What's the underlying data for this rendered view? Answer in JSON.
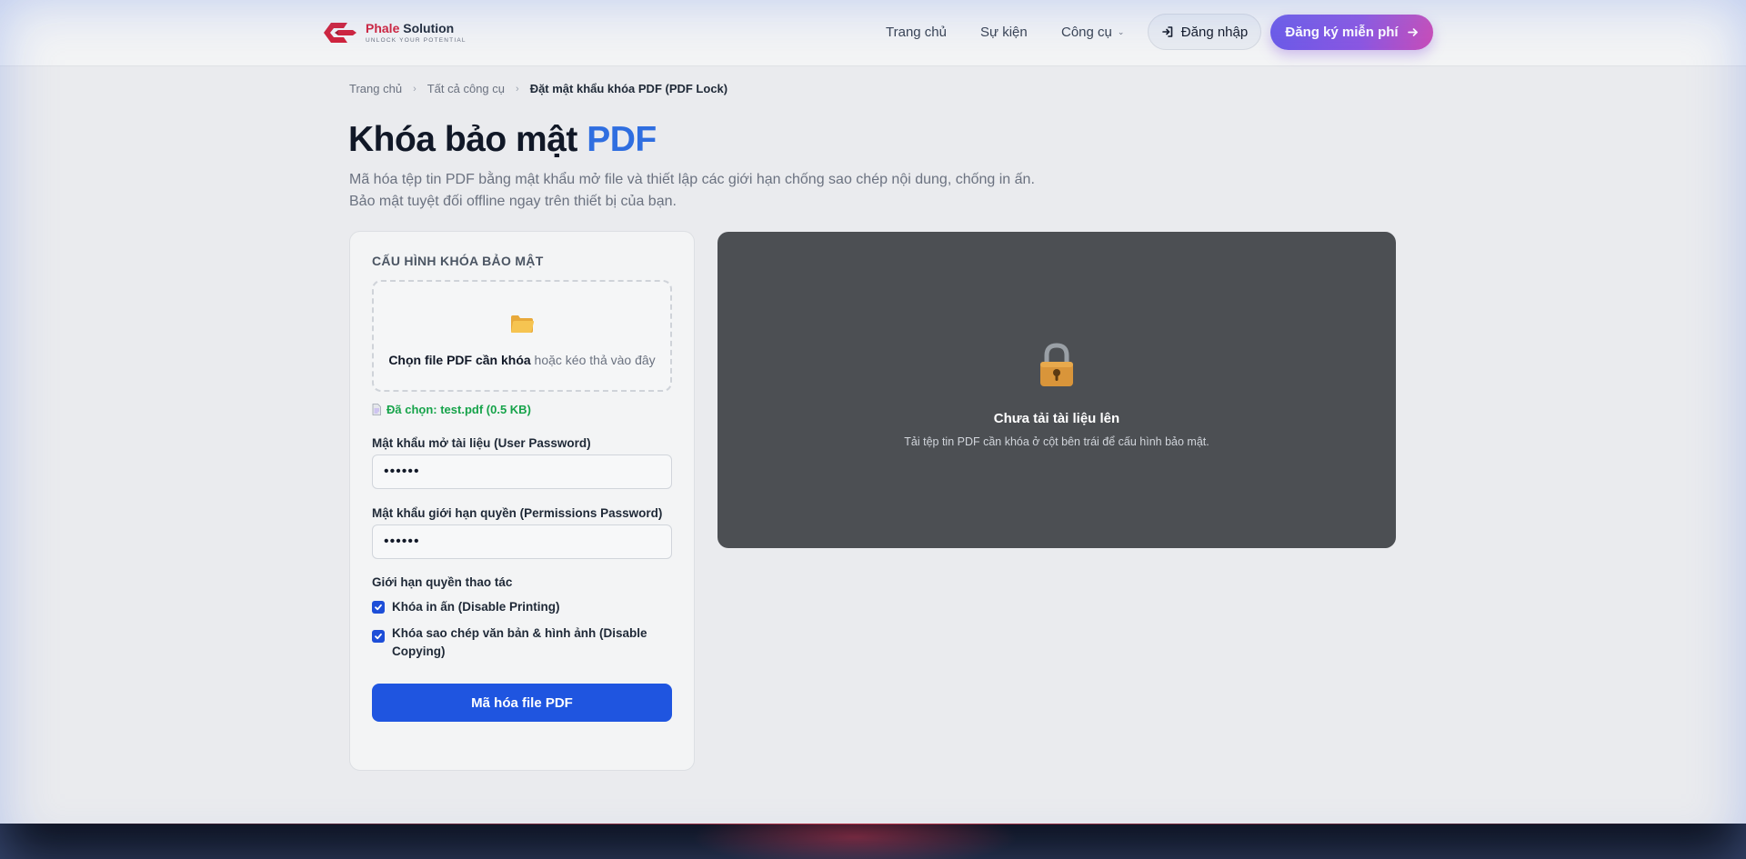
{
  "header": {
    "logo": {
      "brand": "Phale",
      "name": "Solution",
      "tagline": "UNLOCK YOUR POTENTIAL"
    },
    "nav": [
      {
        "label": "Trang chủ"
      },
      {
        "label": "Sự kiện"
      },
      {
        "label": "Công cụ"
      }
    ],
    "login_label": "Đăng nhập",
    "register_label": "Đăng ký miễn phí"
  },
  "breadcrumb": {
    "items": [
      "Trang chủ",
      "Tất cả công cụ"
    ],
    "current": "Đặt mật khẩu khóa PDF (PDF Lock)"
  },
  "page": {
    "title": "Khóa bảo mật",
    "title_accent": "PDF",
    "subtitle_line1": "Mã hóa tệp tin PDF bằng mật khẩu mở file và thiết lập các giới hạn chống sao chép nội dung, chống in ấn.",
    "subtitle_line2": "Bảo mật tuyệt đối offline ngay trên thiết bị của bạn."
  },
  "config": {
    "heading": "CẤU HÌNH KHÓA BẢO MẬT",
    "dropzone_strong": "Chọn file PDF cần khóa",
    "dropzone_rest": " hoặc kéo thả vào đây",
    "selected_file": "Đã chọn: test.pdf (0.5 KB)",
    "user_password_label": "Mật khẩu mở tài liệu (User Password)",
    "user_password_value": "••••••",
    "permissions_password_label": "Mật khẩu giới hạn quyền (Permissions Password)",
    "permissions_password_value": "••••••",
    "permissions_heading": "Giới hạn quyền thao tác",
    "disable_printing_label": "Khóa in ấn (Disable Printing)",
    "disable_printing_checked": true,
    "disable_copying_label": "Khóa sao chép văn bản & hình ảnh (Disable Copying)",
    "disable_copying_checked": true,
    "encrypt_button": "Mã hóa file PDF"
  },
  "preview": {
    "empty_title": "Chưa tải tài liệu lên",
    "empty_desc": "Tải tệp tin PDF cần khóa ở cột bên trái để cấu hình bảo mật."
  },
  "colors": {
    "accent": "#2f6ee0",
    "primary_button": "#1f55e0",
    "success": "#16a34a",
    "preview_bg": "#4c4f53",
    "brand_red": "#d0213a"
  },
  "icons": {
    "logo": "phale-logo-icon",
    "chevron": "chevron-down-icon",
    "login": "sign-in-icon",
    "arrow": "arrow-right-icon",
    "folder": "folder-icon",
    "file": "file-icon",
    "lock": "lock-icon",
    "check": "check-icon"
  }
}
